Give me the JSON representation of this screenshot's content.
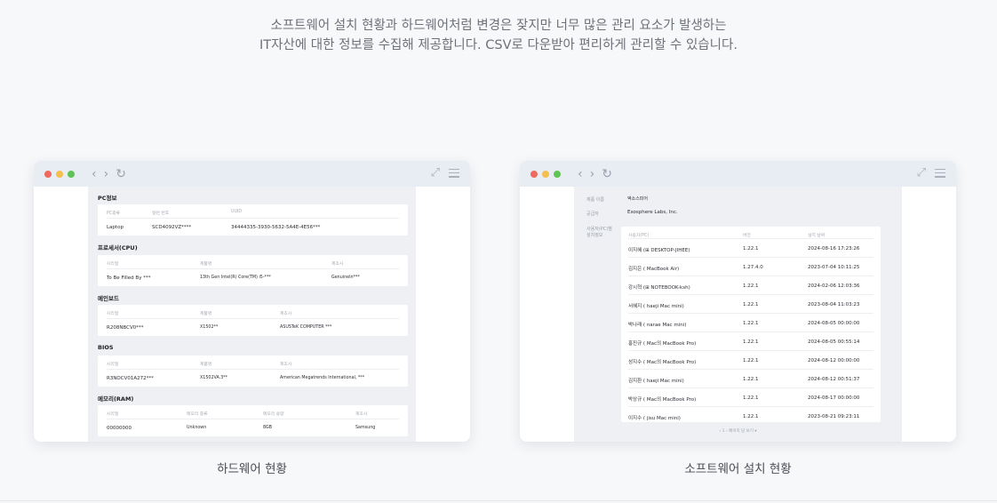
{
  "intro": {
    "line1": "소프트웨어 설치 현황과 하드웨어처럼 변경은 잦지만 너무 많은 관리 요소가 발생하는",
    "line2": "IT자산에 대한 정보를 수집해 제공합니다. CSV로 다운받아 편리하게 관리할 수 있습니다."
  },
  "window_chrome": {
    "back_icon": "chevron-left-icon",
    "forward_icon": "chevron-right-icon",
    "reload_icon": "reload-icon",
    "expand_icon": "expand-icon",
    "menu_icon": "hamburger-menu-icon"
  },
  "hardware": {
    "caption": "하드웨어 현황",
    "sections": [
      {
        "title": "PC정보",
        "headers": [
          "PC종류",
          "일련 번호",
          "UUID"
        ],
        "values": [
          "Laptop",
          "SCD4092VZ****",
          "34444335-3930-5632-5A4E-4E56***"
        ]
      },
      {
        "title": "프로세서(CPU)",
        "headers": [
          "시리얼",
          "제품명",
          "제조사"
        ],
        "values": [
          "To Be Filled By ***",
          "13th Gen Intel(R) Core(TM) i5-***",
          "GenuineIn***"
        ]
      },
      {
        "title": "메인보드",
        "headers": [
          "시리얼",
          "제품명",
          "제조사"
        ],
        "values": [
          "R208NBCV0***",
          "X1502**",
          "ASUSTeK COMPUTER ***"
        ]
      },
      {
        "title": "BIOS",
        "headers": [
          "시리얼",
          "제품명",
          "제조사"
        ],
        "values": [
          "R3NOCV01A272***",
          "X1502VA.3**",
          "American Megatrends International, ***"
        ]
      },
      {
        "title": "메모리(RAM)",
        "headers": [
          "시리얼",
          "메모리 종류",
          "메모리 용량",
          "제조사"
        ],
        "values": [
          "00000000",
          "Unknown",
          "8GB",
          "Samsung"
        ]
      }
    ]
  },
  "software": {
    "caption": "소프트웨어 설치 현황",
    "product_label": "제품 이름",
    "product_value": "엑소스피어",
    "vendor_label": "공급자",
    "vendor_value": "Exosphere Labs, Inc.",
    "users_label_1": "사용자(PC)별",
    "users_label_2": "설치정보",
    "columns": [
      "사용자(PC)",
      "버전",
      "설치 날짜"
    ],
    "rows": [
      {
        "user": "이지혜 (⊞ DESKTOP-JIHEE)",
        "os": "windows",
        "version": "1.22.1",
        "date": "2024-08-16 17:23:26"
      },
      {
        "user": "김지은 ( MacBook Air)",
        "os": "mac",
        "version": "1.27.4.0",
        "date": "2023-07-04 10:11:25"
      },
      {
        "user": "강시혁 (⊞ NOTEBOOK-ksh)",
        "os": "windows",
        "version": "1.22.1",
        "date": "2024-02-06 12:03:36"
      },
      {
        "user": "서혜지 ( haeji Mac mini)",
        "os": "mac",
        "version": "1.22.1",
        "date": "2023-08-04 11:03:23"
      },
      {
        "user": "박나래 ( narae Mac mini)",
        "os": "mac",
        "version": "1.22.1",
        "date": "2024-08-05 00:00:00"
      },
      {
        "user": "홍진규 ( Mac의 MacBook Pro)",
        "os": "mac",
        "version": "1.22.1",
        "date": "2024-08-05 00:55:14"
      },
      {
        "user": "성지수 ( Mac의 MacBook Pro)",
        "os": "mac",
        "version": "1.22.1",
        "date": "2024-08-12 00:00:00"
      },
      {
        "user": "김지환 ( haeji Mac mini)",
        "os": "mac",
        "version": "1.22.1",
        "date": "2024-08-12 00:51:37"
      },
      {
        "user": "박상규 ( Mac의 MacBook Pro)",
        "os": "mac",
        "version": "1.22.1",
        "date": "2024-08-17 00:00:00"
      },
      {
        "user": "이지수 ( jisu Mac mini)",
        "os": "mac",
        "version": "1.22.1",
        "date": "2023-08-21 09:23:11"
      }
    ],
    "pager": "‹ 1 › 페이지 당 보기 ▾"
  }
}
